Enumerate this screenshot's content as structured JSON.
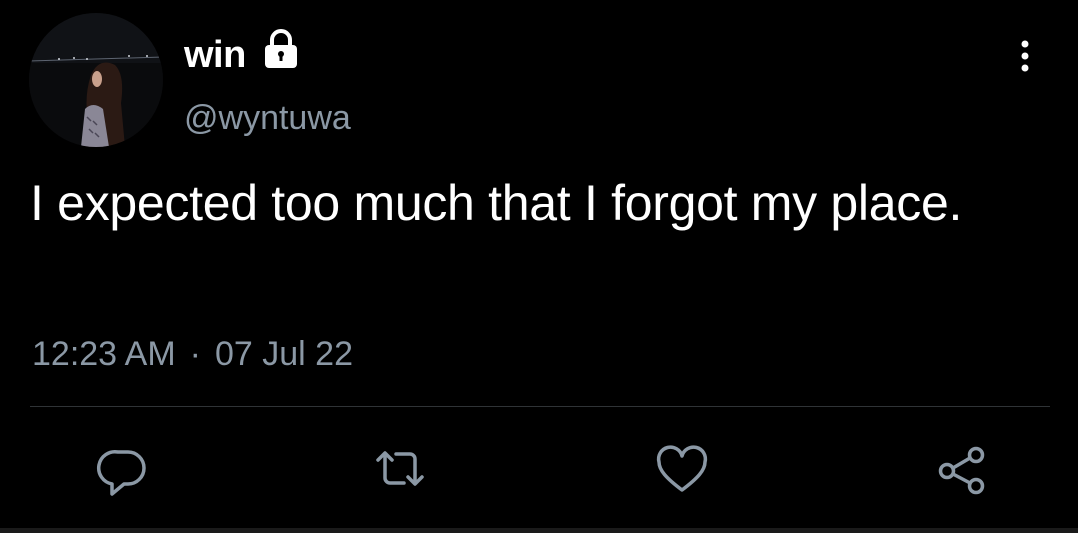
{
  "tweet": {
    "display_name": "win",
    "handle": "@wyntuwa",
    "text": "I expected too much that I forgot my place.",
    "time": "12:23 AM",
    "separator": "·",
    "date": "07 Jul 22"
  },
  "icons": {
    "lock": "lock-icon",
    "more": "more-vertical-icon",
    "reply": "reply-icon",
    "retweet": "retweet-icon",
    "like": "heart-icon",
    "share": "share-icon"
  },
  "colors": {
    "background": "#000000",
    "primary_text": "#ffffff",
    "secondary_text": "#8b98a5",
    "divider": "#2f3336"
  }
}
